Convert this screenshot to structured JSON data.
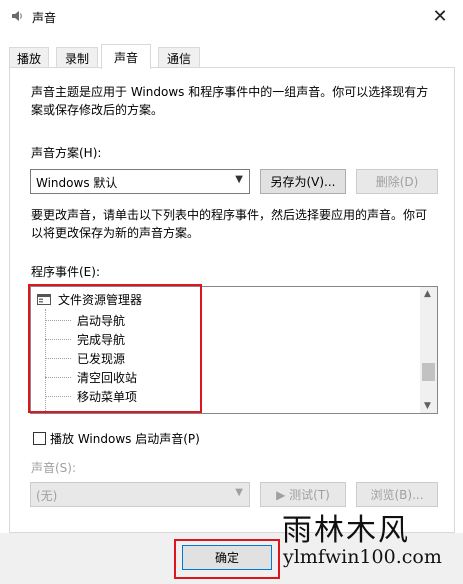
{
  "window": {
    "title": "声音"
  },
  "tabs": [
    {
      "label": "播放",
      "active": false
    },
    {
      "label": "录制",
      "active": false
    },
    {
      "label": "声音",
      "active": true
    },
    {
      "label": "通信",
      "active": false
    }
  ],
  "description": {
    "line1": "声音主题是应用于 Windows 和程序事件中的一组声音。你可以选择现有方",
    "line2": "案或保存修改后的方案。"
  },
  "scheme": {
    "label": "声音方案(H):",
    "value": "Windows 默认",
    "save_as_label": "另存为(V)...",
    "delete_label": "删除(D)"
  },
  "instructions": {
    "line1": "要更改声音，请单击以下列表中的程序事件，然后选择要应用的声音。你可",
    "line2": "以将更改保存为新的声音方案。"
  },
  "events": {
    "label": "程序事件(E):",
    "group": "文件资源管理器",
    "items": [
      "启动导航",
      "完成导航",
      "已发现源",
      "清空回收站",
      "移动菜单项"
    ]
  },
  "startup_sound": {
    "label": "播放 Windows 启动声音(P)",
    "checked": false
  },
  "sound": {
    "label": "声音(S):",
    "value": "(无)",
    "test_label": "▶ 测试(T)",
    "browse_label": "浏览(B)..."
  },
  "footer": {
    "ok_label": "确定"
  },
  "watermark": {
    "line1": "雨林木风",
    "line2": "ylmfwin100.com"
  },
  "colors": {
    "highlight": "#e0151c",
    "accent": "#0078d7"
  }
}
